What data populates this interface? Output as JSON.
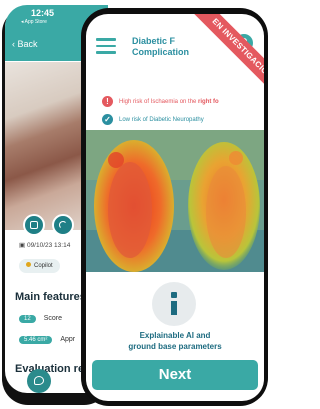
{
  "back_screen": {
    "status_time": "12:45",
    "status_sub": "◂ App Store",
    "back_label": "Back",
    "date": "09/10/23 13:14",
    "copilot_label": "Copilot",
    "main_features_title": "Main features",
    "features": [
      {
        "badge": "12",
        "label": "Score"
      },
      {
        "badge": "5.46 cm²",
        "label": "Appr"
      }
    ],
    "evaluation_title": "Evaluation res"
  },
  "front_screen": {
    "title": "Diabetic F\nComplication",
    "banner": "EN INVESTIGACIÓN",
    "alerts": [
      {
        "icon": "!",
        "text_before": "High risk of Ischaemia on the ",
        "text_bold": "right fo",
        "color": "#e4595f"
      },
      {
        "icon": "✓",
        "text_before": "Low risk of Diabetic Neuropathy",
        "text_bold": "",
        "color": "#2b8fa0"
      }
    ],
    "explain_line1": "Explainable AI and",
    "explain_line2": "ground base parameters",
    "next_label": "Next"
  },
  "colors": {
    "accent": "#3aa9a5",
    "alert_red": "#e4595f",
    "text_teal": "#2b8fa0",
    "dark_teal": "#1d6b80"
  }
}
